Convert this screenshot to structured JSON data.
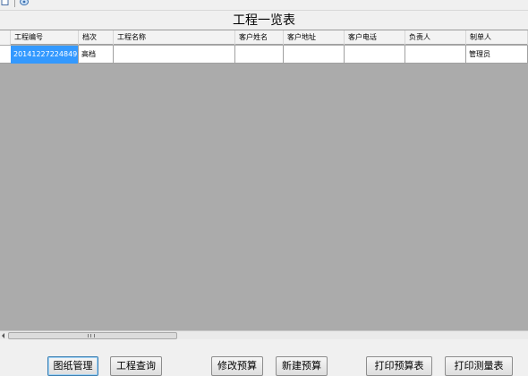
{
  "toolbar": {
    "buttons": [
      {
        "icon": "document-icon"
      },
      {
        "icon": "refresh-icon"
      }
    ]
  },
  "title": "工程一览表",
  "grid": {
    "columns": [
      "工程编号",
      "档次",
      "工程名称",
      "客户姓名",
      "客户地址",
      "客户电话",
      "负责人",
      "制单人"
    ],
    "rows": [
      [
        "20141227224849",
        "高档",
        "",
        "",
        "",
        "",
        "",
        "管理员"
      ]
    ],
    "selected_cell": "20141227224849",
    "background_color": "#ababab",
    "selection_color": "#3399ff"
  },
  "buttons": {
    "drawing_mgmt": "图纸管理",
    "project_query": "工程查询",
    "modify_budget": "修改预算",
    "new_budget": "新建预算",
    "print_budget": "打印预算表",
    "print_survey": "打印测量表"
  }
}
